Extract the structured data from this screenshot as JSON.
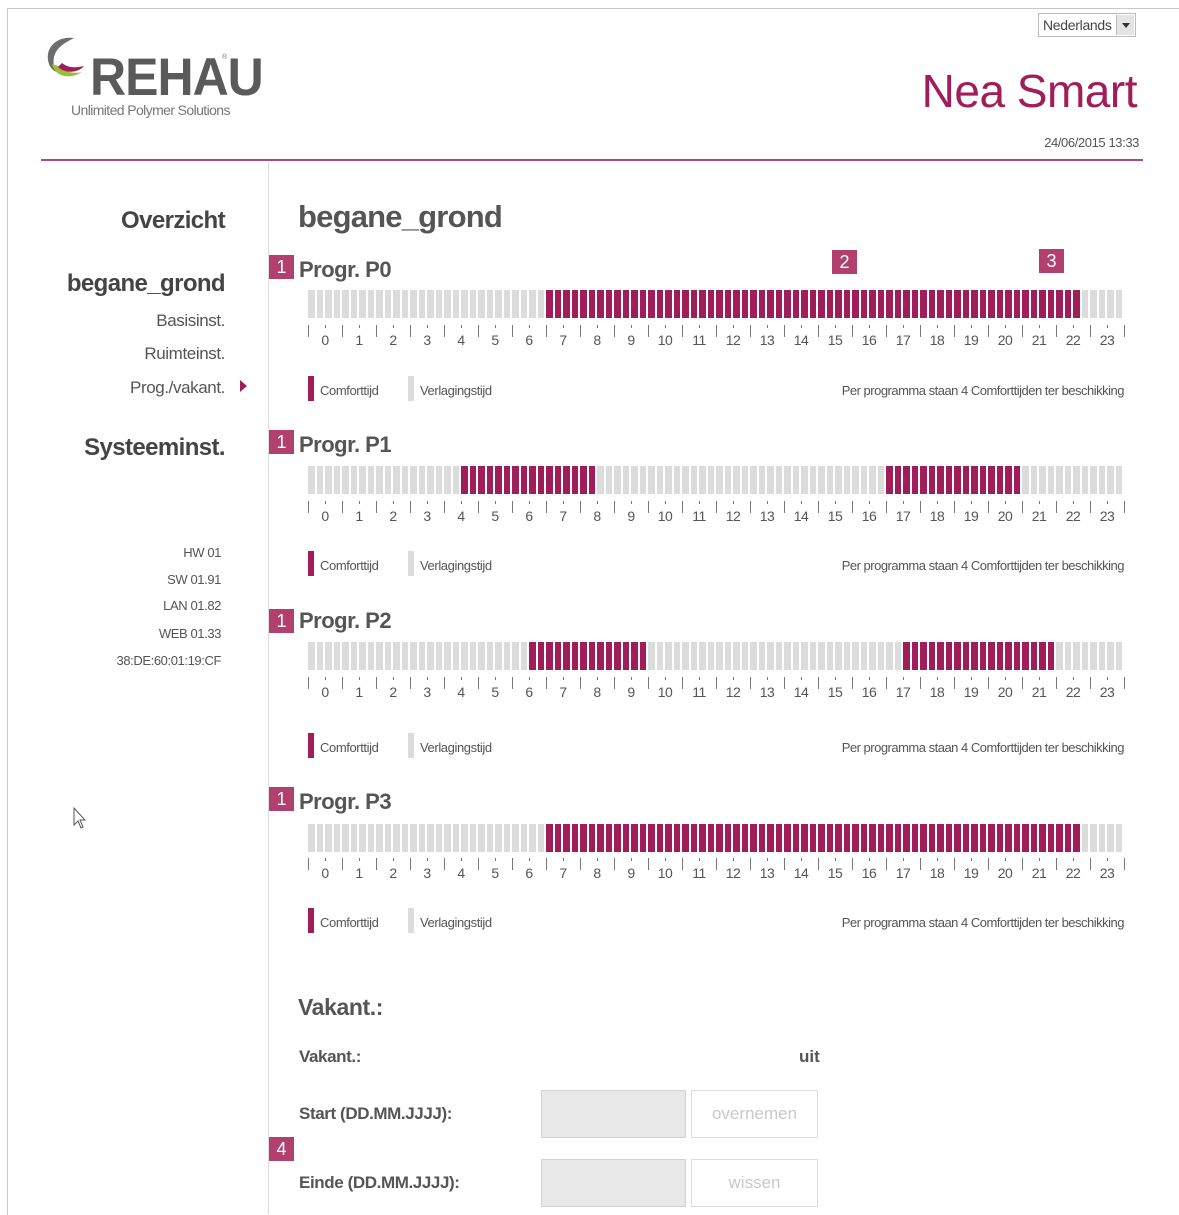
{
  "language": {
    "selected": "Nederlands"
  },
  "brand": {
    "name": "REHAU",
    "tagline": "Unlimited Polymer Solutions"
  },
  "header": {
    "app_title": "Nea Smart",
    "datetime": "24/06/2015 13:33"
  },
  "sidebar": {
    "overview": "Overzicht",
    "zone": "begane_grond",
    "sub_items": [
      "Basisinst.",
      "Ruimteinst.",
      "Prog./vakant."
    ],
    "system": "Systeeminst.",
    "versions": [
      "HW 01",
      "SW 01.91",
      "LAN 01.82",
      "WEB 01.33",
      "38:DE:60:01:19:CF"
    ]
  },
  "main": {
    "title": "begane_grond"
  },
  "markers": [
    "1",
    "2",
    "3",
    "4"
  ],
  "hours": [
    "0",
    "1",
    "2",
    "3",
    "4",
    "5",
    "6",
    "7",
    "8",
    "9",
    "10",
    "11",
    "12",
    "13",
    "14",
    "15",
    "16",
    "17",
    "18",
    "19",
    "20",
    "21",
    "22",
    "23"
  ],
  "programs": [
    {
      "title": "Progr. P0",
      "comfort_periods": [
        [
          7.0,
          22.75
        ]
      ]
    },
    {
      "title": "Progr. P1",
      "comfort_periods": [
        [
          4.5,
          8.5
        ],
        [
          17.0,
          21.0
        ]
      ]
    },
    {
      "title": "Progr. P2",
      "comfort_periods": [
        [
          6.5,
          10.0
        ],
        [
          17.5,
          22.0
        ]
      ]
    },
    {
      "title": "Progr. P3",
      "comfort_periods": [
        [
          7.0,
          22.75
        ]
      ]
    }
  ],
  "legend": {
    "comfort": "Comforttijd",
    "reduced": "Verlagingstijd",
    "note": "Per programma staan 4 Comforttijden ter beschikking",
    "comfort_color": "#a11d5a",
    "reduced_color": "#dcdcdc"
  },
  "vacation": {
    "section_title": "Vakant.:",
    "status_label": "Vakant.:",
    "status_value": "uit",
    "start_label": "Start (DD.MM.JJJJ):",
    "end_label": "Einde (DD.MM.JJJJ):",
    "start_value": "",
    "end_value": "",
    "apply_button": "overnemen",
    "clear_button": "wissen"
  },
  "icons": {
    "cursor": "pointer-cursor-icon",
    "nav_active": "triangle-right-icon",
    "dropdown": "chevron-down-icon"
  }
}
